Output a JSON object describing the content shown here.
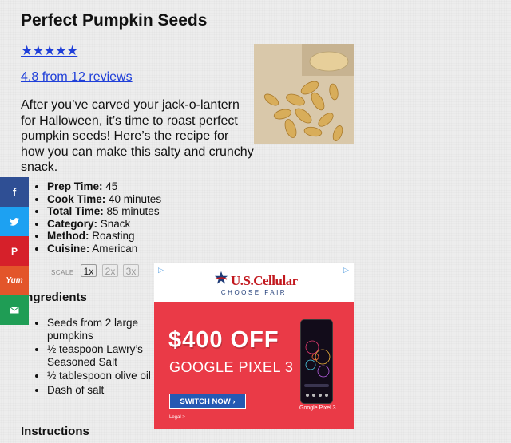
{
  "recipe": {
    "title": "Perfect Pumpkin Seeds",
    "rating_stars": "★★★★★",
    "rating_text": "4.8 from 12 reviews",
    "intro": "After you’ve carved your jack-o-lantern for Halloween, it’s time to roast perfect pumpkin seeds! Here’s the recipe for how you can make this salty and crunchy snack."
  },
  "meta": [
    {
      "label": "Prep Time:",
      "value": "45"
    },
    {
      "label": "Cook Time:",
      "value": "40 minutes"
    },
    {
      "label": "Total Time:",
      "value": "85 minutes"
    },
    {
      "label": "Category:",
      "value": "Snack"
    },
    {
      "label": "Method:",
      "value": "Roasting"
    },
    {
      "label": "Cuisine:",
      "value": "American"
    }
  ],
  "scale": {
    "label": "SCALE",
    "options": [
      "1x",
      "2x",
      "3x"
    ],
    "selected": "1x"
  },
  "sections": {
    "ingredients": "Ingredients",
    "instructions": "Instructions"
  },
  "ingredients": [
    "Seeds from 2 large pumpkins",
    "½ teaspoon Lawry’s Seasoned Salt",
    "½ tablespoon olive oil",
    "Dash of salt"
  ],
  "share": {
    "facebook": "f",
    "pinterest": "P",
    "yummly": "Yum",
    "icons": [
      "facebook-icon",
      "twitter-icon",
      "pinterest-icon",
      "yummly-icon",
      "email-icon"
    ],
    "colors": {
      "facebook": "#2f4f94",
      "twitter": "#1da1f2",
      "pinterest": "#d6202a",
      "yummly": "#e3552a",
      "email": "#1f9d55"
    }
  },
  "ad": {
    "choices_icon": "▷",
    "brand": "U.S.Cellular",
    "tagline": "CHOOSE FAIR",
    "offer": "$400 OFF",
    "model": "GOOGLE PIXEL 3",
    "cta": "SWITCH NOW ›",
    "legal": "Legal >",
    "phone_caption": "Google Pixel 3",
    "colors": {
      "body": "#ea3a47",
      "brand": "#c2181e",
      "cta": "#2559b3"
    }
  },
  "colors": {
    "link": "#1f3fd9"
  }
}
